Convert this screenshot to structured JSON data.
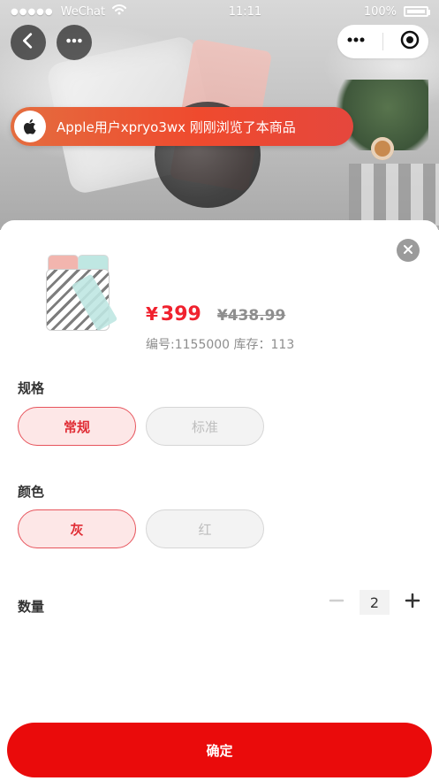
{
  "status_bar": {
    "carrier": "WeChat",
    "time": "11:11",
    "battery": "100%"
  },
  "notice": {
    "text": "Apple用户xpryo3wx 刚刚浏览了本商品",
    "icon": "apple-icon"
  },
  "product": {
    "currency": "¥",
    "price": "399",
    "original_price": "¥438.99",
    "meta": "编号:1155000 库存：113"
  },
  "spec": {
    "title": "规格",
    "options": [
      "常规",
      "标准"
    ],
    "selected_index": 0
  },
  "color": {
    "title": "颜色",
    "options": [
      "灰",
      "红"
    ],
    "selected_index": 0
  },
  "quantity": {
    "title": "数量",
    "value": "2"
  },
  "actions": {
    "confirm_label": "确定"
  },
  "colors": {
    "accent": "#f0212e",
    "confirm": "#ea0b0b",
    "selected_bg": "#fde7e7",
    "disabled_bg": "#f3f3f3",
    "notice_gradient_start": "#e46d3f",
    "notice_gradient_end": "#e5473d"
  }
}
